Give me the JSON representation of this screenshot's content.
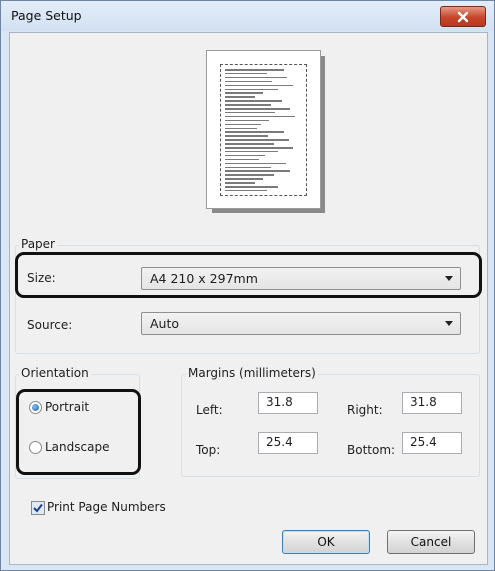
{
  "window": {
    "title": "Page Setup"
  },
  "paper": {
    "group_label": "Paper",
    "size_label": "Size:",
    "size_value": "A4 210 x 297mm",
    "source_label": "Source:",
    "source_value": "Auto"
  },
  "orientation": {
    "group_label": "Orientation",
    "portrait_label": "Portrait",
    "landscape_label": "Landscape",
    "selected": "Portrait"
  },
  "margins": {
    "group_label": "Margins (millimeters)",
    "left_label": "Left:",
    "left_value": "31.8",
    "right_label": "Right:",
    "right_value": "31.8",
    "top_label": "Top:",
    "top_value": "25.4",
    "bottom_label": "Bottom:",
    "bottom_value": "25.4"
  },
  "print_page_numbers": {
    "label": "Print Page Numbers",
    "checked": true
  },
  "buttons": {
    "ok": "OK",
    "cancel": "Cancel"
  },
  "colors": {
    "titlebar": "#d9e6f4",
    "close_button": "#c8452a",
    "dialog_bg": "#f0f0f0",
    "highlight_outline": "#111111",
    "radio_selected": "#1b63b5"
  }
}
